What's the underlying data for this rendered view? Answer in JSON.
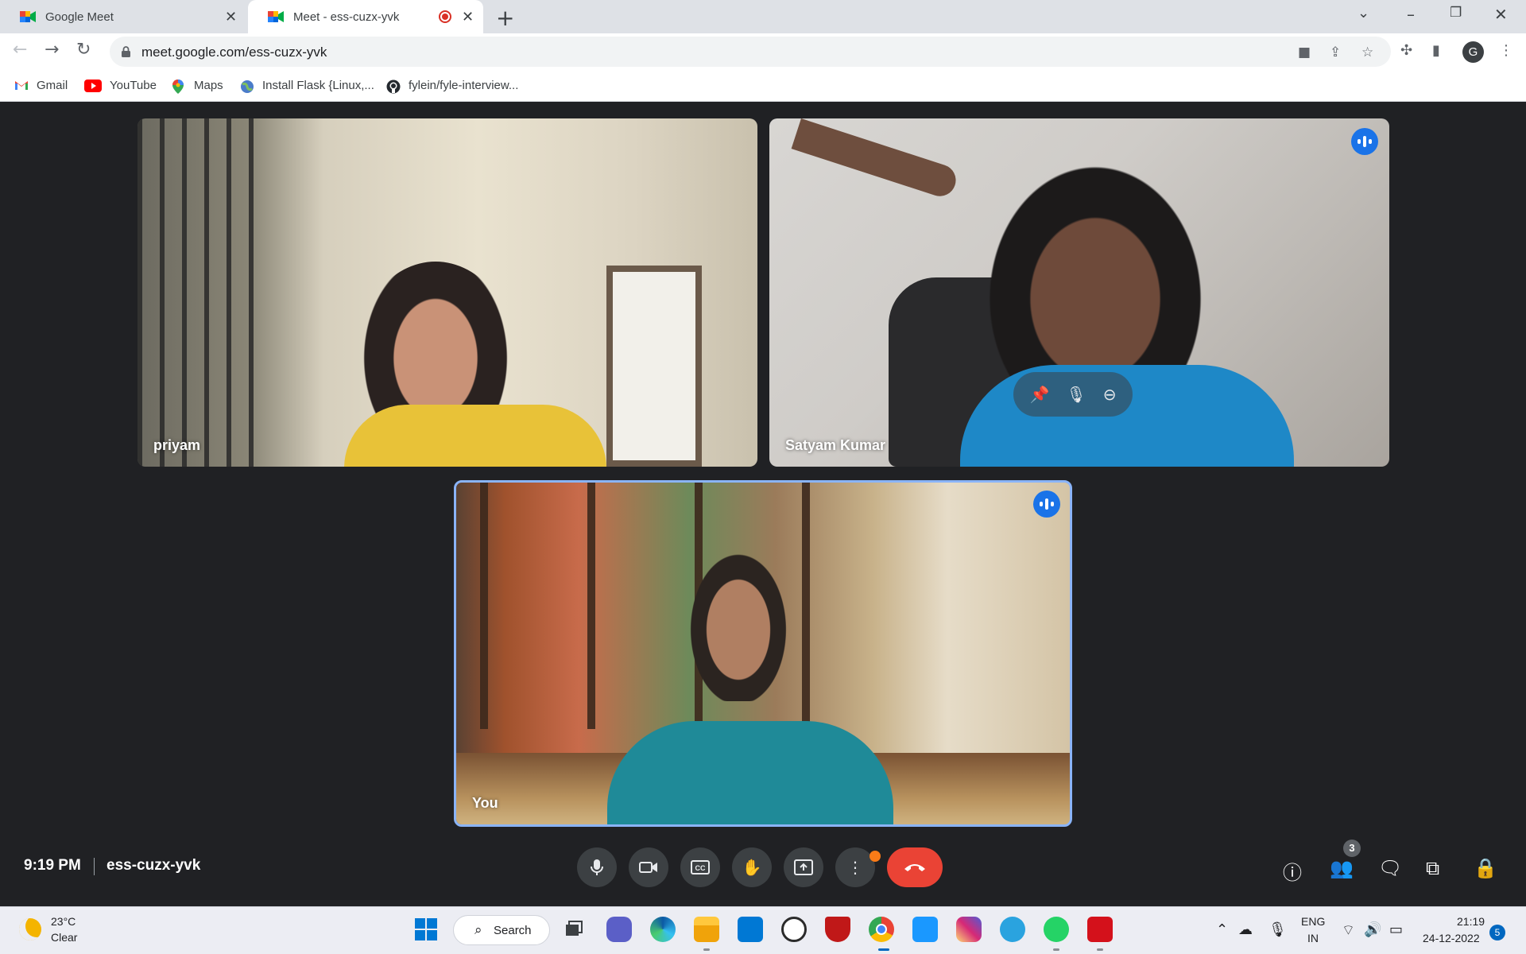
{
  "browser": {
    "tabs": [
      {
        "title": "Google Meet",
        "active": false
      },
      {
        "title": "Meet - ess-cuzx-yvk",
        "active": true,
        "recording": true
      }
    ],
    "new_tab_icon": "plus-icon",
    "window_controls": [
      "chevron-down-icon",
      "minimize-icon",
      "restore-icon",
      "close-icon"
    ],
    "url": "meet.google.com/ess-cuzx-yvk",
    "profile_initial": "G",
    "bookmarks": [
      {
        "label": "Gmail",
        "icon": "gmail-icon"
      },
      {
        "label": "YouTube",
        "icon": "youtube-icon"
      },
      {
        "label": "Maps",
        "icon": "maps-icon"
      },
      {
        "label": "Install Flask {Linux,...",
        "icon": "globe-icon"
      },
      {
        "label": "fylein/fyle-interview...",
        "icon": "github-icon"
      }
    ]
  },
  "meet": {
    "participants": [
      {
        "name": "priyam",
        "speaking": false
      },
      {
        "name": "Satyam Kumar",
        "speaking": true
      },
      {
        "name": "You",
        "speaking": true,
        "self": true
      }
    ],
    "tile_hover_controls": [
      "pin-icon",
      "mic-icon",
      "remove-icon"
    ],
    "time": "9:19 PM",
    "meeting_code": "ess-cuzx-yvk",
    "controls": [
      "mic-icon",
      "camera-icon",
      "captions-icon",
      "raise-hand-icon",
      "present-icon",
      "more-options-icon",
      "end-call-icon"
    ],
    "right_controls": [
      "info-icon",
      "people-icon",
      "chat-icon",
      "activities-icon",
      "host-controls-icon"
    ],
    "people_count": "3",
    "colors": {
      "accent": "#1a73e8",
      "end_call": "#ea4335",
      "background": "#202124",
      "active_tile_border": "#8ab4f8"
    }
  },
  "taskbar": {
    "weather_temp": "23°C",
    "weather_condition": "Clear",
    "search_label": "Search",
    "apps": [
      "windows-start-icon",
      "search-icon",
      "task-view-icon",
      "teams-chat-icon",
      "edge-icon",
      "file-explorer-icon",
      "store-icon",
      "dell-icon",
      "mcafee-icon",
      "chrome-icon",
      "prime-video-icon",
      "instagram-icon",
      "telegram-icon",
      "whatsapp-icon",
      "acrobat-icon"
    ],
    "lang_line1": "ENG",
    "lang_line2": "IN",
    "time": "21:19",
    "date": "24-12-2022",
    "notification_count": "5"
  }
}
